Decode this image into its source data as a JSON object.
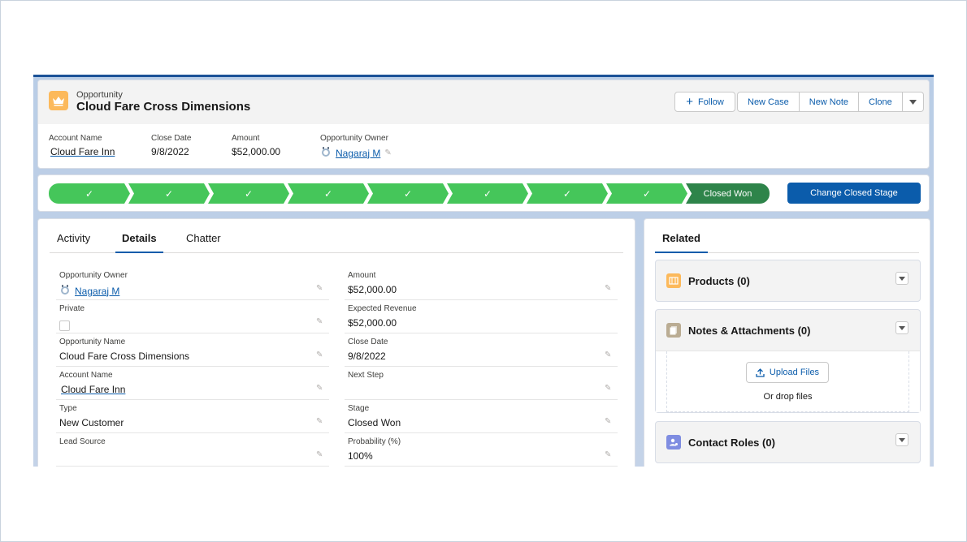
{
  "header": {
    "object_type": "Opportunity",
    "record_title": "Cloud Fare Cross Dimensions",
    "buttons": {
      "follow": "Follow",
      "new_case": "New Case",
      "new_note": "New Note",
      "clone": "Clone"
    },
    "fields": [
      {
        "label": "Account Name",
        "value": "Cloud Fare Inn"
      },
      {
        "label": "Close Date",
        "value": "9/8/2022"
      },
      {
        "label": "Amount",
        "value": "$52,000.00"
      },
      {
        "label": "Opportunity Owner",
        "value": "Nagaraj M"
      }
    ]
  },
  "path": {
    "completed_steps": 8,
    "current_stage": "Closed Won",
    "change_stage_button": "Change Closed Stage"
  },
  "tabs": [
    "Activity",
    "Details",
    "Chatter"
  ],
  "active_tab": "Details",
  "details": {
    "left": [
      {
        "label": "Opportunity Owner",
        "value": "Nagaraj M"
      },
      {
        "label": "Private",
        "value": ""
      },
      {
        "label": "Opportunity Name",
        "value": "Cloud Fare Cross Dimensions"
      },
      {
        "label": "Account Name",
        "value": "Cloud Fare Inn"
      },
      {
        "label": "Type",
        "value": "New Customer"
      },
      {
        "label": "Lead Source",
        "value": ""
      }
    ],
    "right": [
      {
        "label": "Amount",
        "value": "$52,000.00"
      },
      {
        "label": "Expected Revenue",
        "value": "$52,000.00"
      },
      {
        "label": "Close Date",
        "value": "9/8/2022"
      },
      {
        "label": "Next Step",
        "value": ""
      },
      {
        "label": "Stage",
        "value": "Closed Won"
      },
      {
        "label": "Probability (%)",
        "value": "100%"
      }
    ]
  },
  "related": {
    "tab": "Related",
    "cards": [
      {
        "title": "Products (0)",
        "icon": "products-icon",
        "color": "#fcb95b"
      },
      {
        "title": "Notes & Attachments (0)",
        "icon": "notes-icon",
        "color": "#baac93"
      },
      {
        "title": "Contact Roles (0)",
        "icon": "contact-roles-icon",
        "color": "#7f8de1"
      }
    ],
    "upload_label": "Upload Files",
    "drop_text": "Or drop files"
  },
  "colors": {
    "brand": "#0b5cab",
    "path_complete": "#45c65a",
    "path_current": "#2e844a"
  }
}
